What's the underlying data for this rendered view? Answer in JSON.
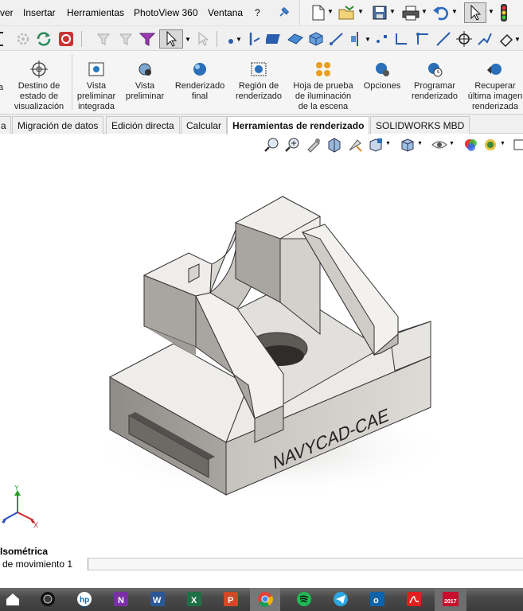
{
  "menubar": {
    "items": [
      "ver",
      "Insertar",
      "Herramientas",
      "PhotoView 360",
      "Ventana",
      "?"
    ]
  },
  "ribbon": {
    "buttons": [
      {
        "label": "a",
        "icon": "display-state-icon"
      },
      {
        "label": "Destino de\nestado de\nvisualización",
        "icon": "display-state-target-icon"
      },
      {
        "label": "Vista\npreliminar\nintegrada",
        "icon": "integrated-preview-icon"
      },
      {
        "label": "Vista\npreliminar",
        "icon": "preview-window-icon"
      },
      {
        "label": "Renderizado\nfinal",
        "icon": "final-render-icon"
      },
      {
        "label": "Región de\nrenderizado",
        "icon": "render-region-icon"
      },
      {
        "label": "Hoja de prueba\nde iluminación\nde la escena",
        "icon": "scene-illumination-proof-sheet-icon"
      },
      {
        "label": "Opciones",
        "icon": "options-icon"
      },
      {
        "label": "Programar\nrenderizado",
        "icon": "schedule-render-icon"
      },
      {
        "label": "Recuperar\núltima imagen\nrenderizada",
        "icon": "recall-last-rendered-image-icon"
      }
    ]
  },
  "tabs": [
    {
      "label": "a"
    },
    {
      "label": "Migración de datos"
    },
    {
      "label": "Edición directa"
    },
    {
      "label": "Calcular"
    },
    {
      "label": "Herramientas de renderizado",
      "active": true
    },
    {
      "label": "SOLIDWORKS MBD"
    }
  ],
  "viewport": {
    "model_text": "NAVYCAD-CAE",
    "triad": {
      "y": "Y",
      "x": "X"
    }
  },
  "status": {
    "view_name": "Isométrica",
    "motion_tab": "de movimiento 1"
  },
  "colors": {
    "ribbon_bg": "#f5f5f5",
    "part_light": "#f4f2ee",
    "part_mid": "#d3d0cb",
    "part_dark": "#9e9b96",
    "taskbar": "#3c3c3c"
  }
}
